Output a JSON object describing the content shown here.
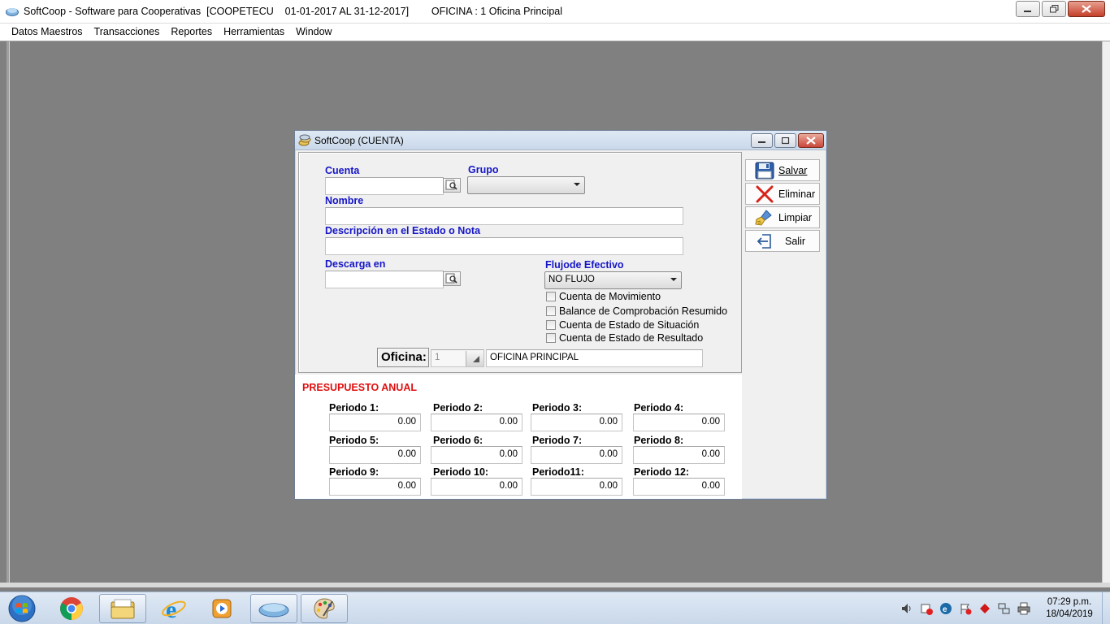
{
  "app": {
    "title": "SoftCoop - Software para Cooperativas  [COOPETECU    01-01-2017 AL 31-12-2017]        OFICINA : 1 Oficina Principal"
  },
  "menu": [
    "Datos Maestros",
    "Transacciones",
    "Reportes",
    "Herramientas",
    "Window"
  ],
  "child": {
    "title": "SoftCoop (CUENTA)",
    "labels": {
      "cuenta": "Cuenta",
      "grupo": "Grupo",
      "nombre": "Nombre",
      "descripcion": "Descripción en el Estado o Nota",
      "descarga": "Descarga en",
      "flujo": "Flujode Efectivo",
      "oficina": "Oficina:"
    },
    "values": {
      "cuenta": "",
      "grupo": "",
      "nombre": "",
      "descripcion": "",
      "descarga": "",
      "flujo": "NO FLUJO",
      "oficina_code": "1",
      "oficina_name": "OFICINA PRINCIPAL"
    },
    "checkboxes": [
      "Cuenta de Movimiento",
      "Balance de Comprobación Resumido",
      "Cuenta de Estado de Situación",
      "Cuenta de Estado de Resultado"
    ],
    "buttons": {
      "salvar": "Salvar",
      "eliminar": "Eliminar",
      "limpiar": "Limpiar",
      "salir": "Salir"
    },
    "presupuesto": {
      "title": "PRESUPUESTO ANUAL",
      "periods": [
        {
          "label": "Periodo 1:",
          "value": "0.00"
        },
        {
          "label": "Periodo 2:",
          "value": "0.00"
        },
        {
          "label": "Periodo 3:",
          "value": "0.00"
        },
        {
          "label": "Periodo 4:",
          "value": "0.00"
        },
        {
          "label": "Periodo 5:",
          "value": "0.00"
        },
        {
          "label": "Periodo 6:",
          "value": "0.00"
        },
        {
          "label": "Periodo 7:",
          "value": "0.00"
        },
        {
          "label": "Periodo 8:",
          "value": "0.00"
        },
        {
          "label": "Periodo 9:",
          "value": "0.00"
        },
        {
          "label": "Periodo 10:",
          "value": "0.00"
        },
        {
          "label": "Periodo11:",
          "value": "0.00"
        },
        {
          "label": "Periodo 12:",
          "value": "0.00"
        }
      ]
    }
  },
  "taskbar": {
    "apps": [
      "windows-explorer",
      "internet-explorer",
      "media-player",
      "softcoop",
      "paint"
    ],
    "clock_time": "07:29 p.m.",
    "clock_date": "18/04/2019"
  },
  "colors": {
    "label_blue": "#1515c8",
    "presupuesto_red": "#e01010",
    "workspace": "#808080"
  }
}
